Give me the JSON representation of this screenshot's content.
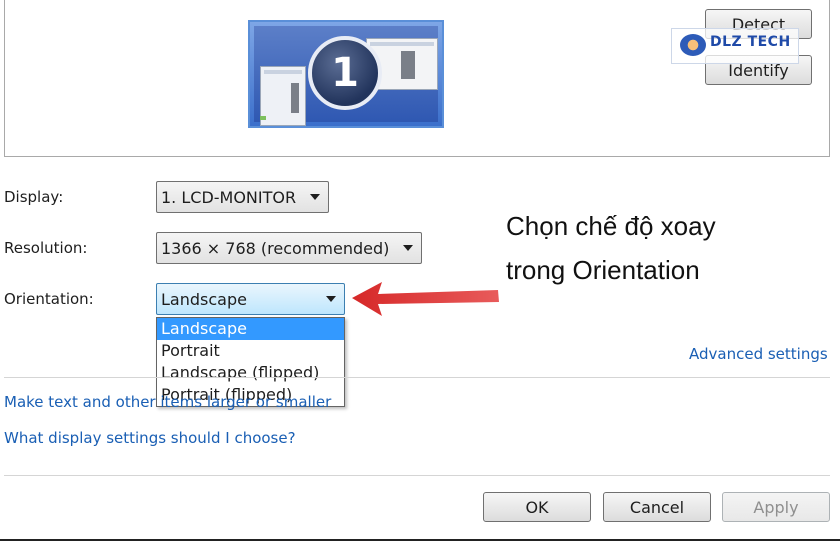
{
  "preview": {
    "monitor_number": "1"
  },
  "buttons": {
    "detect": "Detect",
    "identify": "Identify",
    "ok": "OK",
    "cancel": "Cancel",
    "apply": "Apply"
  },
  "watermark": {
    "text": "DLZ TECH"
  },
  "settings": {
    "display_label": "Display:",
    "display_value": "1. LCD-MONITOR",
    "resolution_label": "Resolution:",
    "resolution_value": "1366 × 768 (recommended)",
    "orientation_label": "Orientation:",
    "orientation_value": "Landscape",
    "orientation_options": [
      "Landscape",
      "Portrait",
      "Landscape (flipped)",
      "Portrait (flipped)"
    ]
  },
  "links": {
    "advanced": "Advanced settings",
    "make_text": "Make text and other items larger or smaller",
    "what_display": "What display settings should I choose?"
  },
  "callout": {
    "line1": "Chọn chế độ xoay",
    "line2": "trong Orientation"
  },
  "colors": {
    "accent_selected": "#3399ff",
    "link": "#1a5fb4",
    "arrow": "#e03a3a"
  }
}
